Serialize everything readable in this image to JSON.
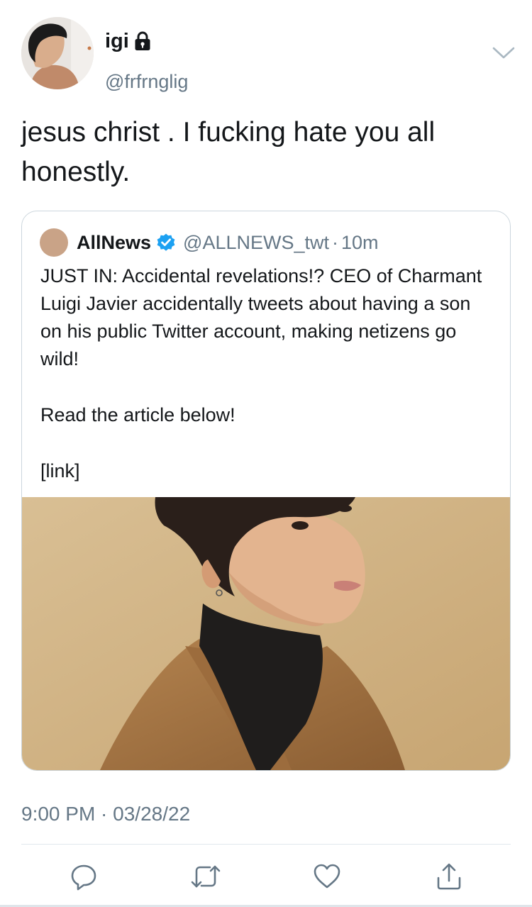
{
  "user": {
    "display_name": "igi",
    "handle": "@frfrnglig",
    "protected_icon": "lock-icon"
  },
  "tweet": {
    "text": "jesus christ . I fucking hate you all honestly.",
    "timestamp": "9:00 PM · 03/28/22"
  },
  "quoted_tweet": {
    "name": "AllNews",
    "verified_icon": "verified-badge-icon",
    "handle": "@ALLNEWS_twt",
    "separator": "·",
    "time": "10m",
    "body": [
      "JUST IN: Accidental revelations!? CEO of Charmant Luigi Javier accidentally tweets about having a son on his public Twitter account, making netizens go wild!",
      "Read the article below!",
      "[link]"
    ]
  },
  "actions": [
    {
      "name": "reply",
      "icon": "reply-icon"
    },
    {
      "name": "retweet",
      "icon": "retweet-icon"
    },
    {
      "name": "like",
      "icon": "heart-icon"
    },
    {
      "name": "share",
      "icon": "share-icon"
    }
  ],
  "colors": {
    "text": "#14171a",
    "secondary": "#657786",
    "verified": "#1da1f2",
    "border": "#ccd6dd",
    "icon": "#657786"
  }
}
